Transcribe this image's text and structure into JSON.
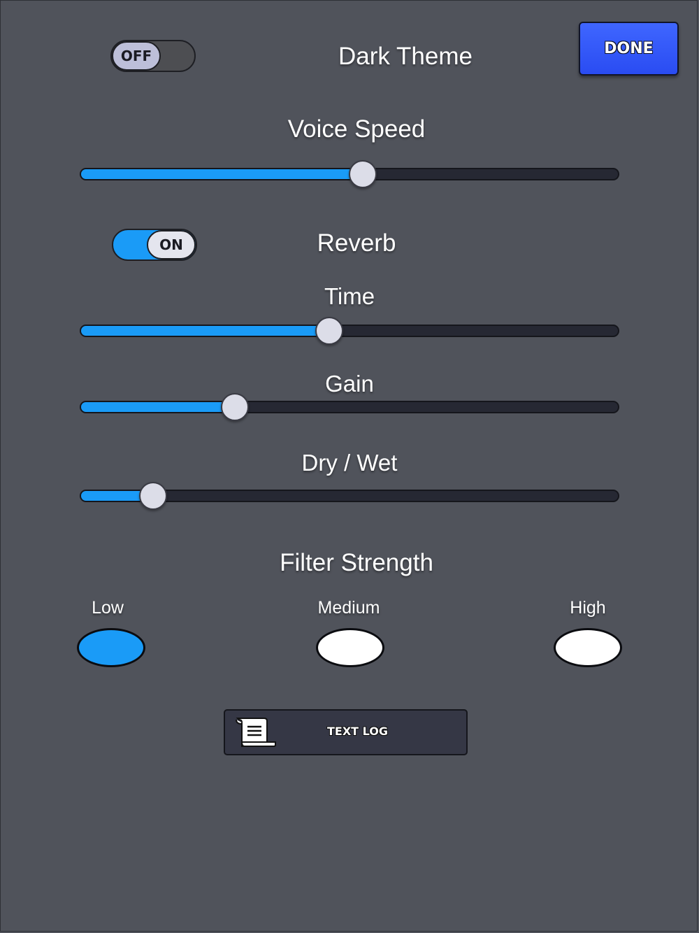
{
  "header": {
    "dark_theme_toggle": {
      "state_label": "OFF",
      "on": false
    },
    "title": "Dark Theme",
    "done_label": "DONE"
  },
  "voice_speed": {
    "label": "Voice Speed",
    "value_fraction": 0.525
  },
  "reverb": {
    "toggle": {
      "state_label": "ON",
      "on": true
    },
    "label": "Reverb",
    "time": {
      "label": "Time",
      "value_fraction": 0.462
    },
    "gain": {
      "label": "Gain",
      "value_fraction": 0.288
    },
    "dry_wet": {
      "label": "Dry / Wet",
      "value_fraction": 0.136
    }
  },
  "filter_strength": {
    "label": "Filter Strength",
    "options": [
      {
        "label": "Low",
        "selected": true
      },
      {
        "label": "Medium",
        "selected": false
      },
      {
        "label": "High",
        "selected": false
      }
    ]
  },
  "text_log_button": {
    "label": "TEXT LOG",
    "icon": "scroll-icon"
  },
  "colors": {
    "background": "#50535b",
    "accent_blue": "#1a9bf7",
    "done_button": "#3358fa",
    "track_dark": "#262833"
  }
}
